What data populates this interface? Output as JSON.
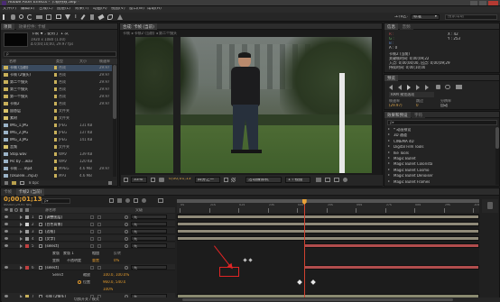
{
  "app": {
    "title": "Adobe After Effects - 卡帧特效.aep *"
  },
  "menu": [
    "文件(F)",
    "编辑(E)",
    "合成(C)",
    "图层(L)",
    "效果(T)",
    "动画(A)",
    "视图(V)",
    "窗口(W)",
    "帮助(H)"
  ],
  "toolbar": {
    "workspace_label": "工作区:",
    "workspace_value": "标准",
    "search_placeholder": "搜索帮助"
  },
  "project": {
    "tab": "项目",
    "tab2": "效果控件: 卡帧",
    "info_title": "卡帧 ▼ , 使用了 1 次",
    "info_size": "1920 x 1080 (1.00)",
    "info_duration": "Δ 0;00;10;00, 29.97 fps",
    "columns": [
      "名称",
      "类型",
      "大小",
      "帧速率"
    ],
    "rows": [
      {
        "name": "卡帧 (当前)",
        "type": "合成",
        "size": "",
        "rate": "29.97",
        "color": "#c8b05a"
      },
      {
        "name": "卡帧 (2镜头)",
        "type": "合成",
        "size": "",
        "rate": "29.97",
        "color": "#c8b05a"
      },
      {
        "name": "第二个镜头",
        "type": "合成",
        "size": "",
        "rate": "29.97",
        "color": "#c8b05a"
      },
      {
        "name": "第三个镜头",
        "type": "合成",
        "size": "",
        "rate": "29.97",
        "color": "#c8b05a"
      },
      {
        "name": "第一个镜头",
        "type": "合成",
        "size": "",
        "rate": "29.97",
        "color": "#c8b05a"
      },
      {
        "name": "卡帧2",
        "type": "合成",
        "size": "",
        "rate": "29.97",
        "color": "#c8b05a"
      },
      {
        "name": "固态层",
        "type": "文件夹",
        "size": "",
        "rate": "",
        "color": "#d9c36a"
      },
      {
        "name": "素材",
        "type": "文件夹",
        "size": "",
        "rate": "",
        "color": "#d9c36a"
      },
      {
        "name": "IMG_1.JPG",
        "type": "JPEG",
        "size": "131 KB",
        "rate": "",
        "color": "#9bb3c7"
      },
      {
        "name": "IMG_2.JPG",
        "type": "JPEG",
        "size": "137 KB",
        "rate": "",
        "color": "#9bb3c7"
      },
      {
        "name": "IMG_3.JPG",
        "type": "JPEG",
        "size": "141 KB",
        "rate": "",
        "color": "#9bb3c7"
      },
      {
        "name": "音频",
        "type": "文件夹",
        "size": "",
        "rate": "",
        "color": "#d9c36a"
      },
      {
        "name": "Stop.wav",
        "type": "WAV",
        "size": "139 KB",
        "rate": "",
        "color": "#9bb3c7"
      },
      {
        "name": "Pic by ...wav",
        "type": "WAV",
        "size": "120 KB",
        "rate": "",
        "color": "#9bb3c7"
      },
      {
        "name": "卡帧 ... .mp4",
        "type": "MPEG",
        "size": "4.6 MB",
        "rate": "29.97",
        "color": "#9bb3c7"
      },
      {
        "name": "(Ukulele...mp3)",
        "type": "MP3",
        "size": "4.6 MB",
        "rate": "",
        "color": "#9bb3c7"
      }
    ],
    "bpc": "8 bpc"
  },
  "viewer": {
    "tab": "合成: 卡帧 (当前)",
    "breadcrumb": "卡帧 ◂ 卡帧2 (当前) ◂ 第二个镜头",
    "zoom": "33%",
    "timecode": "0;00;01;13",
    "resolution": "四分之一",
    "camera": "活动摄像机",
    "views": "1个视图"
  },
  "info": {
    "tab": "信息",
    "tab2": "音频",
    "r": "R :",
    "g": "G :",
    "b": "B :",
    "a": "A : 0",
    "x": "X : 42",
    "y": "Y : 253",
    "layer_line": "卡帧2 (当前)",
    "time_line1": "关键帧时间: 0;00;09;22",
    "time_line2": "入点: 0;00;00;00, 出点: 0;00;09;29",
    "time_line3": "持续时间: 0;00;10;00"
  },
  "preview": {
    "tab": "预览",
    "ram_label": "RAM 预览选项",
    "frame_rate_label": "帧速率",
    "skip_label": "跳过",
    "resolution_label": "分辨率",
    "frame_rate": "(29.97)",
    "skip": "0",
    "resolution": "自动"
  },
  "effects": {
    "tab": "效果和预设",
    "tab2": "字符",
    "search_placeholder": "ρ▾",
    "items": [
      "* 动画预设",
      "3D 通道",
      "CINEMA 4D",
      "Digital Film Tools",
      "Ike Tools",
      "Magic Bullet",
      "Magic Bullet Colorista",
      "Magic Bullet Cosmo",
      "Magic Bullet Denoiser",
      "Magic Bullet Frames"
    ]
  },
  "timeline": {
    "tab": "卡帧",
    "tab2": "卡帧2 (当前)",
    "timecode": "0;00;01;13",
    "fps_line": "00043 (29.97 fps)",
    "search_placeholder": "ρ▾",
    "columns": {
      "source": "源名称",
      "parent": "父级"
    },
    "ruler_ticks": [
      "0s",
      "01s",
      "02s",
      "03s",
      "04s",
      "05s",
      "06s",
      "07s",
      "08s",
      "09s",
      "10s"
    ],
    "playhead": 0.42,
    "layers": [
      {
        "num": "1",
        "name": "[调整图层]",
        "parent": "无",
        "color": "#9c9c9c",
        "bar_start": 0.0,
        "bar_end": 1.0,
        "bar_color": "#8f8a79"
      },
      {
        "num": "2",
        "name": "[白色背景]",
        "parent": "无",
        "color": "#d0d0d0",
        "bar_start": 0.0,
        "bar_end": 1.0,
        "bar_color": "#8f8a79"
      },
      {
        "num": "3",
        "name": "[边框]",
        "parent": "无",
        "color": "#9c9c9c",
        "bar_start": 0.0,
        "bar_end": 1.0,
        "bar_color": "#8f8a79"
      },
      {
        "num": "4",
        "name": "[文字]",
        "parent": "无",
        "color": "#9c9c9c",
        "bar_start": 0.0,
        "bar_end": 1.0,
        "bar_color": "#8f8a79"
      },
      {
        "num": "5",
        "name": "[select]",
        "parent": "无",
        "color": "#c04040",
        "bar_start": 0.42,
        "bar_end": 1.0,
        "bar_color": "#b14d4d"
      }
    ],
    "sub1": {
      "label": "蒙版",
      "sub": "蒙版 1",
      "value": "相加",
      "invert": "反转"
    },
    "sub2": {
      "label": "变换",
      "value": "重置",
      "sub": "不透明度",
      "sub_value": "0%"
    },
    "layer6": {
      "num": "6",
      "name": "[select]",
      "parent": "无",
      "color": "#c04040",
      "bar_start": 0.42,
      "bar_end": 1.0,
      "bar_color": "#b14d4d"
    },
    "sub3": {
      "label": "Select",
      "prop1": "缩放",
      "value1": "100.0, 100.0%",
      "prop2": "位置",
      "value2": "960.0, 540.0"
    },
    "sub4": {
      "value": "100%"
    },
    "layer7": {
      "num": "7",
      "name": "卡帧 (2镜头)",
      "parent": "无",
      "color": "#c8b05a",
      "bar_start": 0.0,
      "bar_end": 1.0,
      "bar_color": "#8a8a70"
    },
    "footer": "切换开关 / 模式"
  }
}
